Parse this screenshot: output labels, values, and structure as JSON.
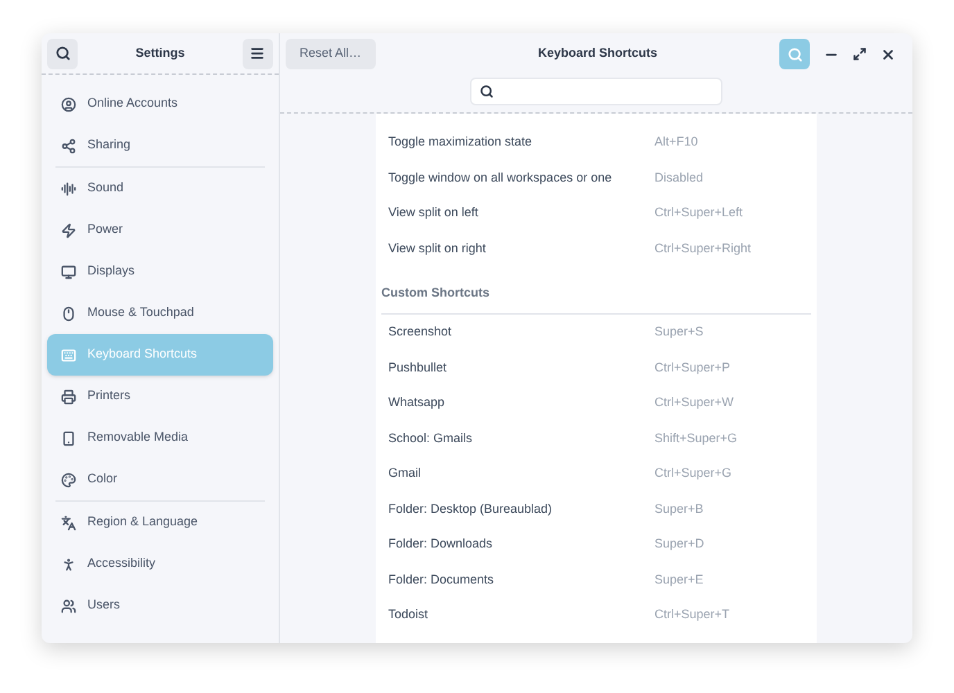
{
  "sidebar": {
    "title": "Settings",
    "groups": [
      [
        {
          "label": "Online Accounts",
          "selected": false
        },
        {
          "label": "Sharing",
          "selected": false
        }
      ],
      [
        {
          "label": "Sound",
          "selected": false
        },
        {
          "label": "Power",
          "selected": false
        },
        {
          "label": "Displays",
          "selected": false
        },
        {
          "label": "Mouse & Touchpad",
          "selected": false
        },
        {
          "label": "Keyboard Shortcuts",
          "selected": true
        },
        {
          "label": "Printers",
          "selected": false
        },
        {
          "label": "Removable Media",
          "selected": false
        },
        {
          "label": "Color",
          "selected": false
        }
      ],
      [
        {
          "label": "Region & Language",
          "selected": false
        },
        {
          "label": "Accessibility",
          "selected": false
        },
        {
          "label": "Users",
          "selected": false
        }
      ]
    ]
  },
  "header": {
    "reset_button": "Reset All…",
    "title": "Keyboard Shortcuts",
    "search_active": true
  },
  "shortcuts": [
    {
      "name": "Toggle maximization state",
      "keys": "Alt+F10"
    },
    {
      "name": "Toggle window on all workspaces or one",
      "keys": "Disabled"
    },
    {
      "name": "View split on left",
      "keys": "Ctrl+Super+Left"
    },
    {
      "name": "View split on right",
      "keys": "Ctrl+Super+Right"
    }
  ],
  "custom_section": {
    "title": "Custom Shortcuts",
    "rows": [
      {
        "name": "Screenshot",
        "keys": "Super+S"
      },
      {
        "name": "Pushbullet",
        "keys": "Ctrl+Super+P"
      },
      {
        "name": "Whatsapp",
        "keys": "Ctrl+Super+W"
      },
      {
        "name": "School: Gmails",
        "keys": "Shift+Super+G"
      },
      {
        "name": "Gmail",
        "keys": "Ctrl+Super+G"
      },
      {
        "name": "Folder: Desktop (Bureaublad)",
        "keys": "Super+B"
      },
      {
        "name": "Folder: Downloads",
        "keys": "Super+D"
      },
      {
        "name": "Folder: Documents",
        "keys": "Super+E"
      },
      {
        "name": "Todoist",
        "keys": "Ctrl+Super+T"
      }
    ]
  }
}
